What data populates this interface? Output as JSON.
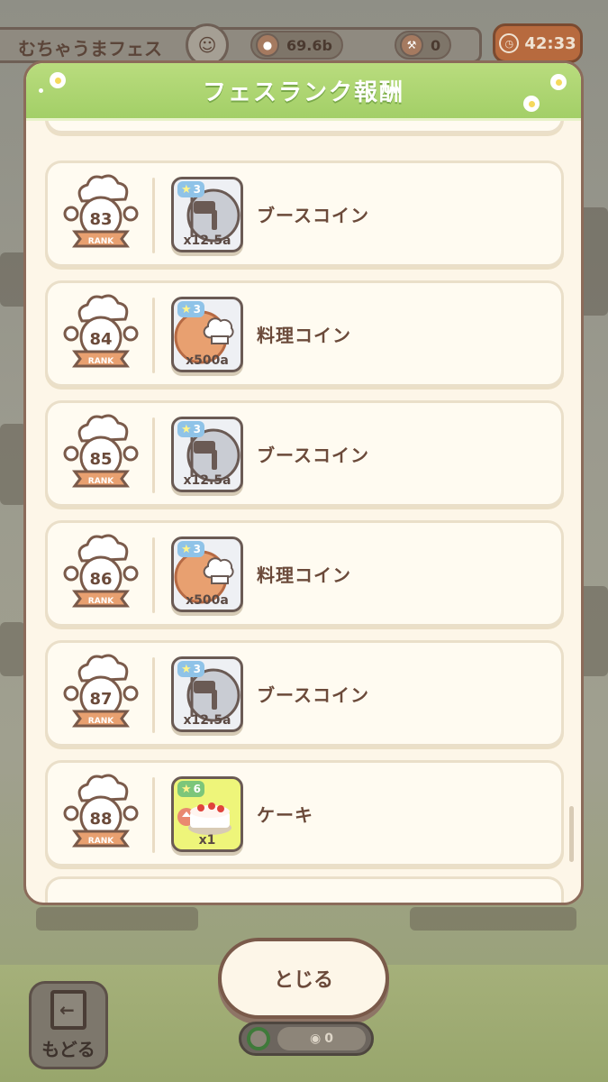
{
  "hud": {
    "title": "むちゃうまフェス",
    "badge_icon": "chef-face-icon",
    "coin_value": "69.6b",
    "hammer_value": "0",
    "timer": "42:33"
  },
  "modal": {
    "title": "フェスランク報酬",
    "rank_word": "RANK",
    "rows": [
      {
        "rank": "83",
        "item": "ブースコイン",
        "qty": "x12.5a",
        "stars": "3",
        "icon": "booth-coin-icon",
        "style": "gray"
      },
      {
        "rank": "84",
        "item": "料理コイン",
        "qty": "x500a",
        "stars": "3",
        "icon": "cooking-coin-icon",
        "style": "gray"
      },
      {
        "rank": "85",
        "item": "ブースコイン",
        "qty": "x12.5a",
        "stars": "3",
        "icon": "booth-coin-icon",
        "style": "gray"
      },
      {
        "rank": "86",
        "item": "料理コイン",
        "qty": "x500a",
        "stars": "3",
        "icon": "cooking-coin-icon",
        "style": "gray"
      },
      {
        "rank": "87",
        "item": "ブースコイン",
        "qty": "x12.5a",
        "stars": "3",
        "icon": "booth-coin-icon",
        "style": "gray"
      },
      {
        "rank": "88",
        "item": "ケーキ",
        "qty": "x1",
        "stars": "6",
        "icon": "cake-icon",
        "style": "yellow"
      }
    ]
  },
  "bottom": {
    "close_label": "とじる",
    "back_label": "もどる",
    "pill_value": "0"
  },
  "colors": {
    "header_green": "#a3cf67",
    "panel_cream": "#fdf6e8",
    "text_brown": "#6b4a3a",
    "timer_orange": "#b76a3e"
  }
}
